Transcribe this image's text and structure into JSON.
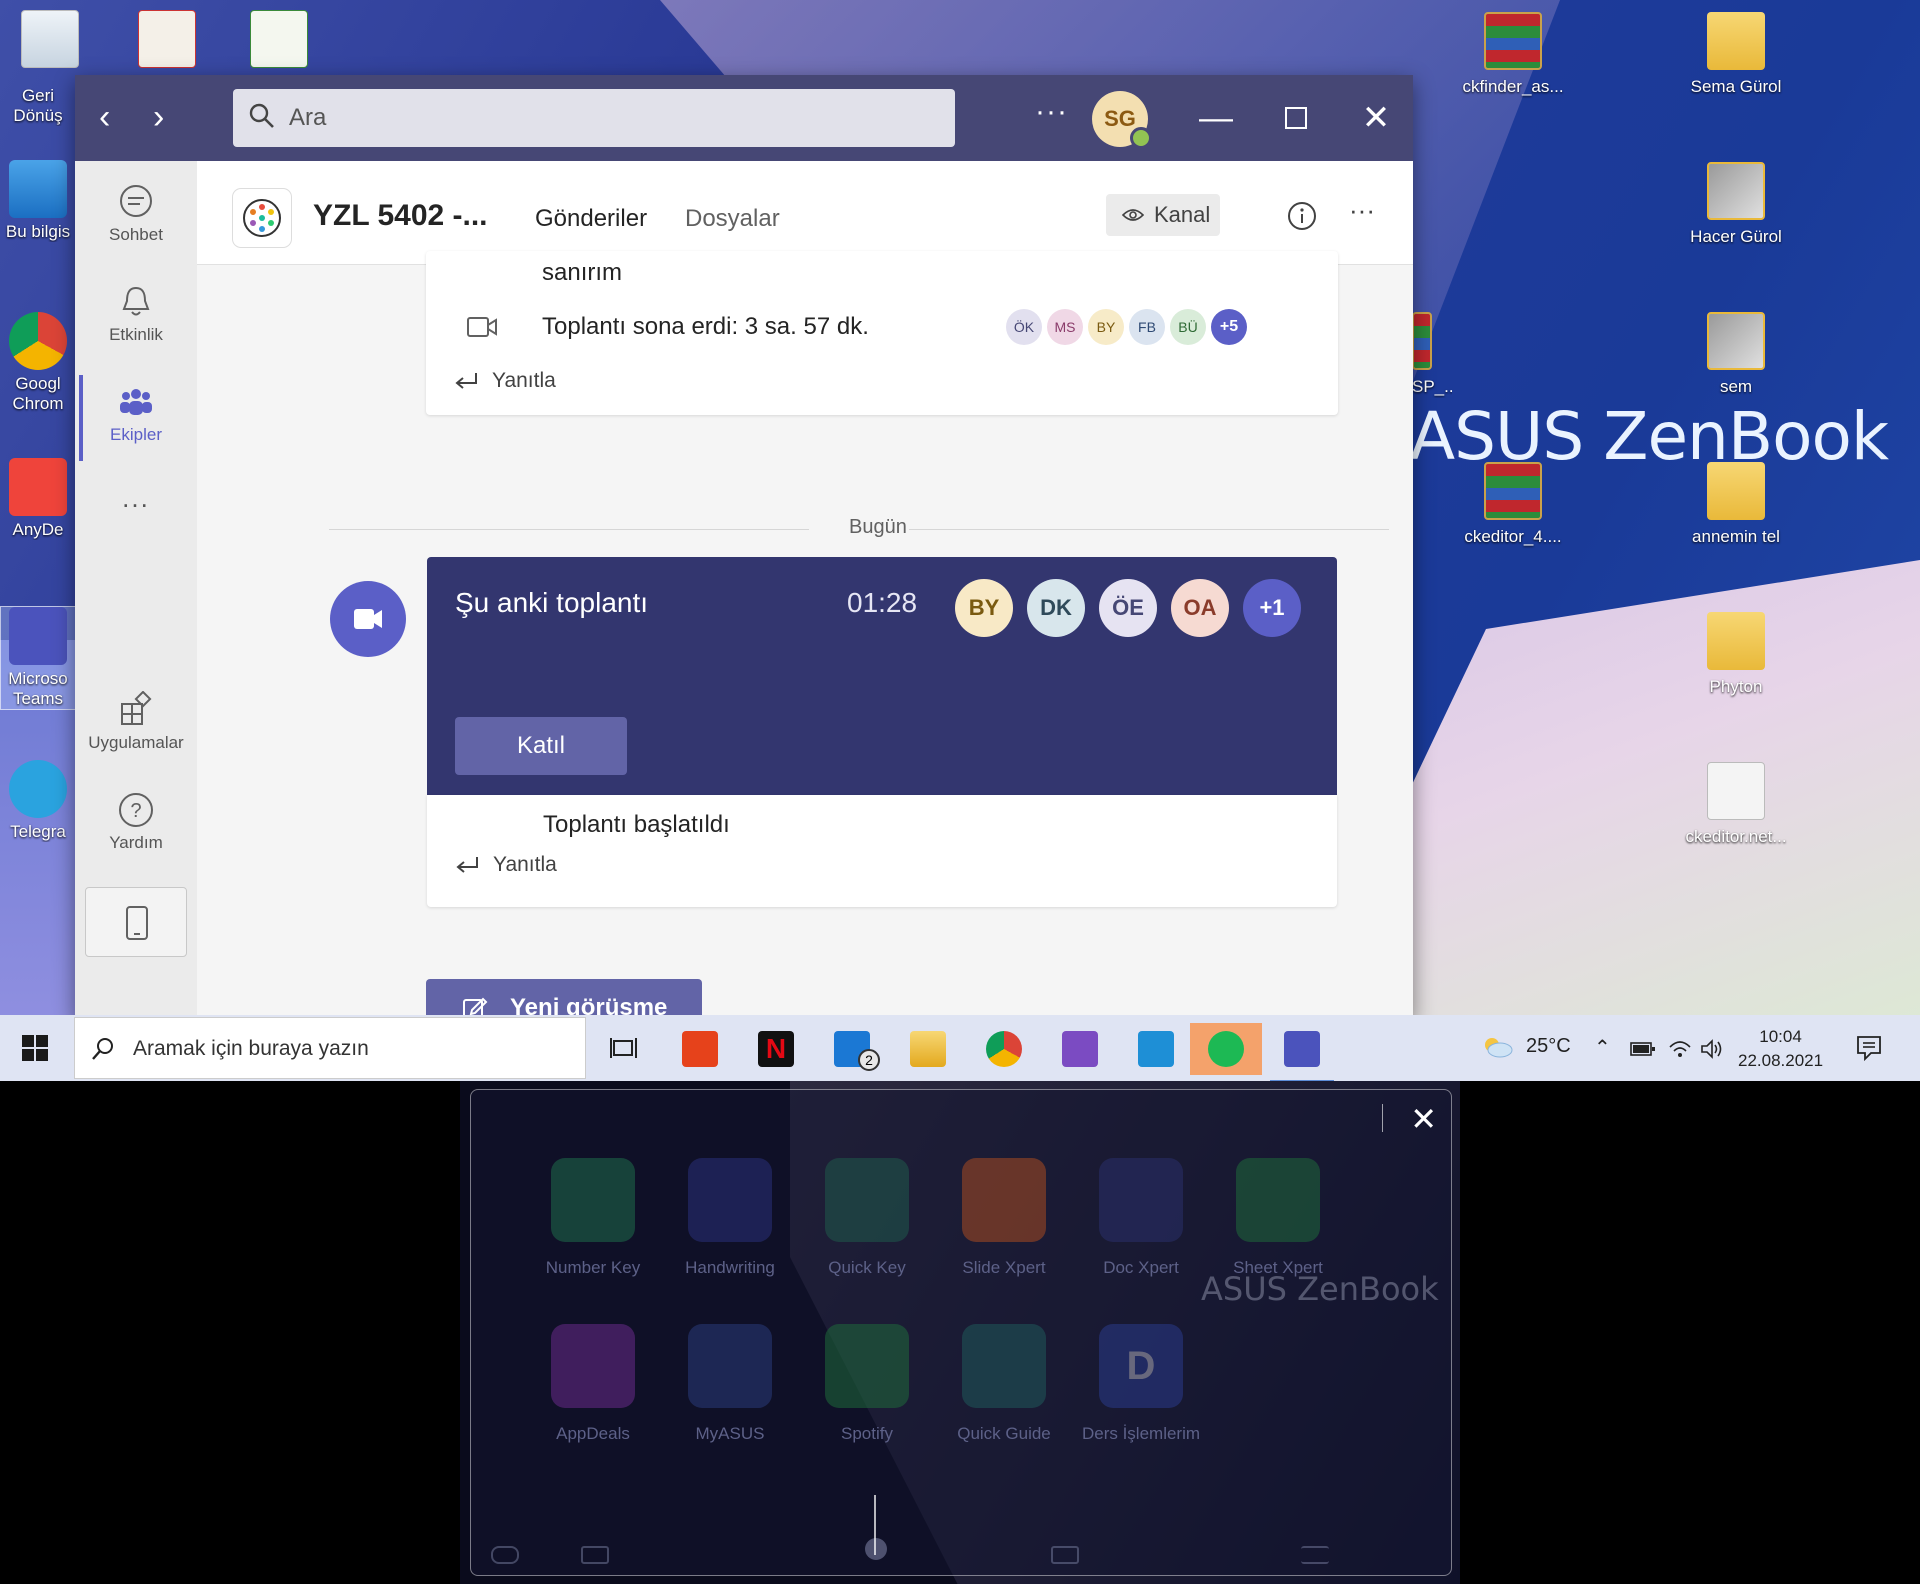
{
  "desktop": {
    "brand": "ASUS ZenBook",
    "icons_right": [
      {
        "label": "ckfinder_as...",
        "kind": "rar"
      },
      {
        "label": "Sema Gürol",
        "kind": "folder"
      },
      {
        "label": "Hacer Gürol",
        "kind": "photo"
      },
      {
        "label": "sem",
        "kind": "photo"
      },
      {
        "label": "SP_...",
        "kind": "rar"
      },
      {
        "label": "ckeditor_4....",
        "kind": "rar"
      },
      {
        "label": "annemin tel",
        "kind": "folder"
      },
      {
        "label": "Phyton",
        "kind": "folder"
      },
      {
        "label": "ckeditor.net...",
        "kind": "doc"
      }
    ],
    "icons_left": [
      {
        "label": "Geri Dönüş"
      },
      {
        "label": "Bu bilgis"
      },
      {
        "label": "Googl Chrom"
      },
      {
        "label": "AnyDe"
      },
      {
        "label": "Microso Teams"
      },
      {
        "label": "Telegra"
      }
    ]
  },
  "teams": {
    "search_placeholder": "Ara",
    "user_initials": "SG",
    "rail": [
      {
        "label": "Sohbet"
      },
      {
        "label": "Etkinlik"
      },
      {
        "label": "Ekipler"
      },
      {
        "label": "..."
      },
      {
        "label": "Uygulamalar"
      },
      {
        "label": "Yardım"
      }
    ],
    "channel": {
      "title": "YZL 5402 -...",
      "tabs": [
        "Gönderiler",
        "Dosyalar"
      ],
      "kanal_label": "Kanal"
    },
    "prev_card": {
      "top_text": "sanırım",
      "ended_text": "Toplantı sona erdi: 3 sa. 57 dk.",
      "participants": [
        {
          "initials": "ÖK",
          "bg": "#e2e0ef",
          "fg": "#464775"
        },
        {
          "initials": "MS",
          "bg": "#f0d8e6",
          "fg": "#8a3b6a"
        },
        {
          "initials": "BY",
          "bg": "#f7ebc8",
          "fg": "#7a5a10"
        },
        {
          "initials": "FB",
          "bg": "#dbe4f0",
          "fg": "#2f4a74"
        },
        {
          "initials": "BÜ",
          "bg": "#d9ecd9",
          "fg": "#2f6a35"
        }
      ],
      "more": "+5",
      "reply": "Yanıtla"
    },
    "today_label": "Bugün",
    "meeting": {
      "title": "Şu anki toplantı",
      "time": "01:28",
      "participants": [
        {
          "initials": "BY",
          "bg": "#f8e9c6",
          "fg": "#7a5a10"
        },
        {
          "initials": "DK",
          "bg": "#d8e6ec",
          "fg": "#2f4a5a"
        },
        {
          "initials": "ÖE",
          "bg": "#e6e3f2",
          "fg": "#464775"
        },
        {
          "initials": "OA",
          "bg": "#f6dad2",
          "fg": "#8a3b2a"
        }
      ],
      "more": "+1",
      "join": "Katıl",
      "started": "Toplantı başlatıldı",
      "reply": "Yanıtla"
    },
    "new_conversation": "Yeni görüşme"
  },
  "taskbar": {
    "search_placeholder": "Aramak için buraya yazın",
    "mail_badge": "2",
    "weather": "25°C",
    "time": "10:04",
    "date": "22.08.2021"
  },
  "screenpad": {
    "apps": [
      {
        "label": "Number Key",
        "color": "#1f6b4a"
      },
      {
        "label": "Handwriting",
        "color": "#2a2f7a"
      },
      {
        "label": "Quick Key",
        "color": "#1f5a4a"
      },
      {
        "label": "Slide Xpert",
        "color": "#a84a20"
      },
      {
        "label": "Doc Xpert",
        "color": "#2a2f6a"
      },
      {
        "label": "Sheet Xpert",
        "color": "#1f6a3a"
      },
      {
        "label": "AppDeals",
        "color": "#6a2a8a"
      },
      {
        "label": "MyASUS",
        "color": "#2a3a7a"
      },
      {
        "label": "Spotify",
        "color": "#1f6a3a"
      },
      {
        "label": "Quick Guide",
        "color": "#1f5a5a"
      },
      {
        "label": "Ders İşlemlerim",
        "initial": "D",
        "color": "#2a3a8a"
      }
    ],
    "brand": "ASUS ZenBook"
  },
  "colors": {
    "teams_accent": "#5b5fc7",
    "teams_titlebar": "#464775",
    "meeting_card": "#33366f"
  }
}
